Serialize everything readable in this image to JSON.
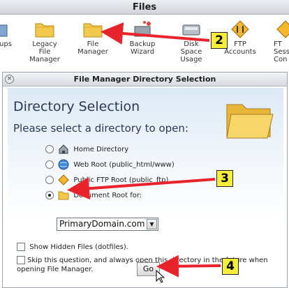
{
  "cpanel": {
    "section_title": "Files",
    "items": [
      {
        "label_lines": [
          "ups"
        ],
        "icon": "backups-icon"
      },
      {
        "label_lines": [
          "Legacy",
          "File",
          "Manager"
        ],
        "icon": "folder-icon"
      },
      {
        "label_lines": [
          "File",
          "Manager"
        ],
        "icon": "folder-icon"
      },
      {
        "label_lines": [
          "Backup",
          "Wizard"
        ],
        "icon": "backup-wizard-icon"
      },
      {
        "label_lines": [
          "Disk",
          "Space",
          "Usage"
        ],
        "icon": "disk-icon"
      },
      {
        "label_lines": [
          "FTP",
          "Accounts"
        ],
        "icon": "ftp-icon"
      },
      {
        "label_lines": [
          "FT",
          "Sess",
          "Con"
        ],
        "icon": "ftp-session-icon"
      }
    ]
  },
  "dialog": {
    "title": "File Manager Directory Selection",
    "close_glyph": "×",
    "heading": "Directory Selection",
    "prompt": "Please select a directory to open:",
    "options": [
      {
        "label": "Home Directory",
        "selected": false,
        "icon": "home-icon"
      },
      {
        "label": "Web Root (public_html/www)",
        "selected": false,
        "icon": "globe-icon"
      },
      {
        "label": "Public FTP Root (public_ftp)",
        "selected": false,
        "icon": "ftp-icon"
      },
      {
        "label": "Document Root for:",
        "selected": true,
        "icon": "folder-icon"
      }
    ],
    "domain_select": {
      "value": "PrimaryDomain.com",
      "arrow": "▼"
    },
    "show_hidden": {
      "label": "Show Hidden Files (dotfiles).",
      "checked": false
    },
    "skip_question": {
      "label": "Skip this question, and always open this directory in the future when opening File Manager.",
      "checked": false
    },
    "go_label": "Go"
  },
  "callouts": [
    "2",
    "3",
    "4"
  ],
  "colors": {
    "callout_fill": "#f7ee3a",
    "arrow": "#e8232b",
    "heading": "#2a3a55",
    "folder": "#f2c94c"
  }
}
